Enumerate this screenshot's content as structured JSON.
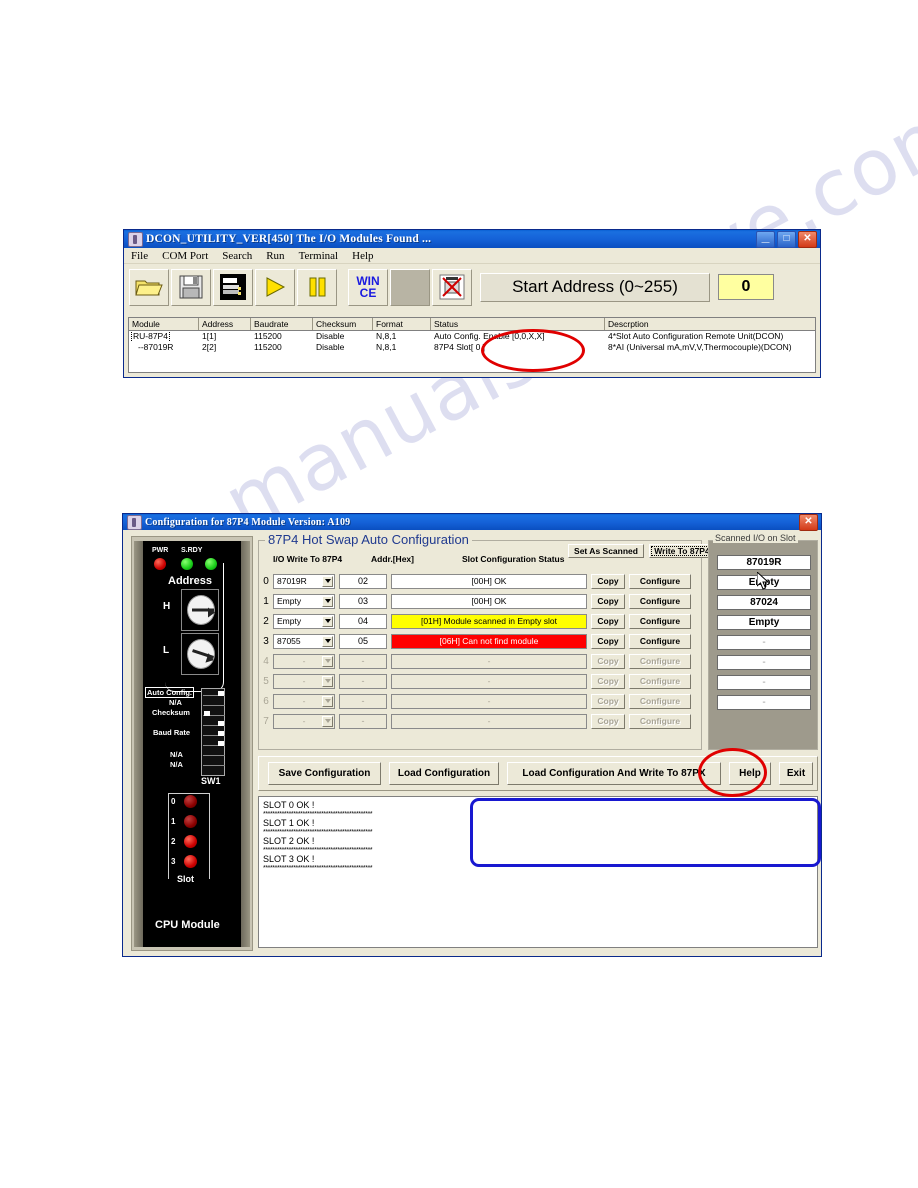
{
  "watermark": {
    "text": "manualsarchive.com"
  },
  "window1": {
    "title": "DCON_UTILITY_VER[450] The I/O Modules Found ...",
    "window_buttons": {
      "minimize": "_",
      "maximize": "□",
      "close": "✕"
    },
    "menu": [
      "File",
      "COM Port",
      "Search",
      "Run",
      "Terminal",
      "Help"
    ],
    "toolbar": {
      "icons": [
        "open-folder-icon",
        "save-floppy-icon",
        "module-list-icon",
        "run-play-icon",
        "pause-icon",
        "wince-icon",
        "blank-icon",
        "stop-search-icon"
      ],
      "wince_line1": "WIN",
      "wince_line2": "CE",
      "start_address_label": "Start Address (0~255)",
      "start_address_value": "0"
    },
    "grid": {
      "headers": [
        "Module",
        "Address",
        "Baudrate",
        "Checksum",
        "Format",
        "Status",
        "Descrption"
      ],
      "rows": [
        {
          "module": "RU-87P4",
          "address": "1[1]",
          "baudrate": "115200",
          "checksum": "Disable",
          "format": "N,8,1",
          "status": "Auto Config. Enable [0,0,X,X]",
          "description": "4*Slot Auto Configuration Remote Unit(DCON)"
        },
        {
          "module": "--87019R",
          "address": "2[2]",
          "baudrate": "115200",
          "checksum": "Disable",
          "format": "N,8,1",
          "status": "87P4 Slot[ 0 ]",
          "description": "8*AI (Universal mA,mV,V,Thermocouple)(DCON)"
        }
      ]
    }
  },
  "window2": {
    "title": "Configuration for 87P4 Module Version: A109",
    "close_button": "✕",
    "device": {
      "led_labels": [
        "PWR",
        "S.RDY"
      ],
      "address_label": "Address",
      "rotary_h": "H",
      "rotary_l": "L",
      "switch_labels": [
        "Auto Config.",
        "N/A",
        "Checksum",
        "Baud Rate",
        "N/A",
        "N/A"
      ],
      "switch_name": "SW1",
      "slot_numbers": [
        "0",
        "1",
        "2",
        "3"
      ],
      "slot_label": "Slot",
      "module_label": "CPU Module"
    },
    "config_group": {
      "legend": "87P4 Hot Swap Auto Configuration",
      "col_io_write": "I/O Write To 87P4",
      "col_addr_hex": "Addr.[Hex]",
      "col_status": "Slot Configuration Status",
      "set_as_scanned": "Set As Scanned",
      "write_to_87p4": "Write To 87P4",
      "copy_label": "Copy",
      "configure_label": "Configure",
      "rows": [
        {
          "index": "0",
          "module": "87019R",
          "addr": "02",
          "status": "[00H] OK",
          "state": "ok",
          "enabled": true
        },
        {
          "index": "1",
          "module": "Empty",
          "addr": "03",
          "status": "[00H] OK",
          "state": "ok",
          "enabled": true
        },
        {
          "index": "2",
          "module": "Empty",
          "addr": "04",
          "status": "[01H] Module scanned in Empty slot",
          "state": "warn",
          "enabled": true
        },
        {
          "index": "3",
          "module": "87055",
          "addr": "05",
          "status": "[06H] Can not find module",
          "state": "error",
          "enabled": true
        },
        {
          "index": "4",
          "module": "-",
          "addr": "-",
          "status": "-",
          "state": "disabled",
          "enabled": false
        },
        {
          "index": "5",
          "module": "-",
          "addr": "-",
          "status": "-",
          "state": "disabled",
          "enabled": false
        },
        {
          "index": "6",
          "module": "-",
          "addr": "-",
          "status": "-",
          "state": "disabled",
          "enabled": false
        },
        {
          "index": "7",
          "module": "-",
          "addr": "-",
          "status": "-",
          "state": "disabled",
          "enabled": false
        }
      ]
    },
    "scanned_panel": {
      "legend": "Scanned I/O on Slot",
      "items": [
        {
          "value": "87019R",
          "enabled": true
        },
        {
          "value": "Empty",
          "enabled": true
        },
        {
          "value": "87024",
          "enabled": true
        },
        {
          "value": "Empty",
          "enabled": true
        },
        {
          "value": "-",
          "enabled": false
        },
        {
          "value": "-",
          "enabled": false
        },
        {
          "value": "-",
          "enabled": false
        },
        {
          "value": "-",
          "enabled": false
        }
      ]
    },
    "actions": {
      "save": "Save Configuration",
      "load": "Load Configuration",
      "load_write": "Load  Configuration And Write To 87PX",
      "help": "Help",
      "exit": "Exit"
    },
    "log": {
      "lines": [
        "SLOT 0 OK !",
        "SLOT 1 OK !",
        "SLOT 2 OK !",
        "SLOT 3 OK !"
      ],
      "separator": "***********************************************"
    }
  },
  "annotations": {
    "colors": {
      "red": "#e00000",
      "blue": "#1818d0"
    },
    "items": [
      {
        "name": "status-highlight-ellipse",
        "shape": "ellipse",
        "color": "#e00000"
      },
      {
        "name": "help-button-ellipse",
        "shape": "ellipse",
        "color": "#e00000"
      },
      {
        "name": "log-empty-rectangle",
        "shape": "rectangle",
        "color": "#1818d0"
      }
    ]
  }
}
